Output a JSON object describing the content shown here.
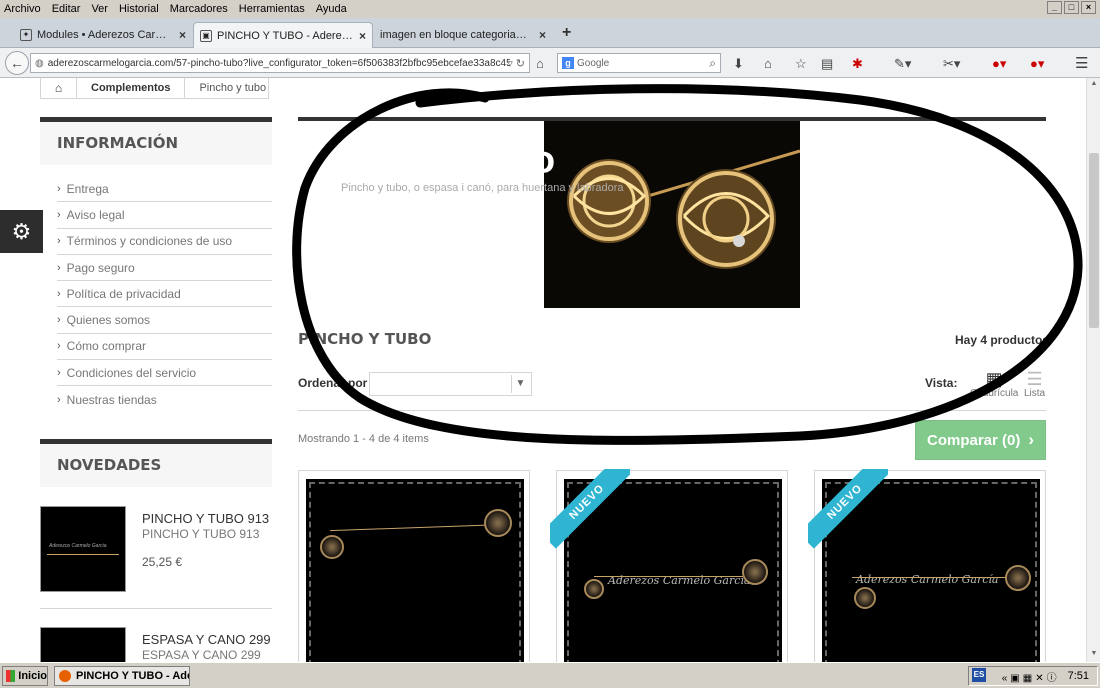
{
  "menubar": {
    "items": [
      "Archivo",
      "Editar",
      "Ver",
      "Historial",
      "Marcadores",
      "Herramientas",
      "Ayuda"
    ]
  },
  "tabs": [
    {
      "label": "Modules • Aderezos Carmelo ..."
    },
    {
      "label": "PINCHO Y TUBO - Aderezos C..."
    },
    {
      "label": "imagen en bloque categorias prest..."
    }
  ],
  "nav": {
    "url": "aderezoscarmelogarcia.com/57-pincho-tubo?live_configurator_token=6f506383f2bfbc95ebcefae33a8c45f38",
    "search_placeholder": "Google"
  },
  "breadcrumb": {
    "level1": "Complementos",
    "level2": "Pincho y tubo"
  },
  "sidebar": {
    "info_title": "INFORMACIÓN",
    "info_items": [
      "Entrega",
      "Aviso legal",
      "Términos y condiciones de uso",
      "Pago seguro",
      "Política de privacidad",
      "Quienes somos",
      "Cómo comprar",
      "Condiciones del servicio",
      "Nuestras tiendas"
    ],
    "new_title": "NOVEDADES",
    "new_items": [
      {
        "name": "PINCHO Y TUBO 913",
        "sub": "PINCHO Y TUBO 913",
        "price": "25,25 €"
      },
      {
        "name": "ESPASA Y CANO 299",
        "sub": "ESPASA Y CANO 299",
        "price": ""
      }
    ],
    "thumb_watermark": "Aderezos Carmelo Garcia"
  },
  "category": {
    "title_overlay": "DO",
    "description": "Pincho y tubo, o espasa i canó, para huertana y labradora",
    "heading": "PINCHO Y TUBO",
    "count": "Hay 4 productos",
    "sort_label": "Ordenar por",
    "view_label": "Vista:",
    "view_grid": "Cuadrícula",
    "view_list": "Lista",
    "showing": "Mostrando 1 - 4 de 4 items",
    "compare": "Comparar (0)"
  },
  "products": [
    {
      "badge": "",
      "watermark": ""
    },
    {
      "badge": "NUEVO",
      "watermark": "Aderezos Carmelo García"
    },
    {
      "badge": "NUEVO",
      "watermark": "Aderezos Carmelo García"
    }
  ],
  "taskbar": {
    "start": "Inicio",
    "window": "PINCHO Y TUBO - Ader...",
    "lang": "ES",
    "clock": "7:51"
  },
  "colors": {
    "compare_button": "#82c98c",
    "new_ribbon": "#2fb5d2",
    "heading": "#555555"
  }
}
